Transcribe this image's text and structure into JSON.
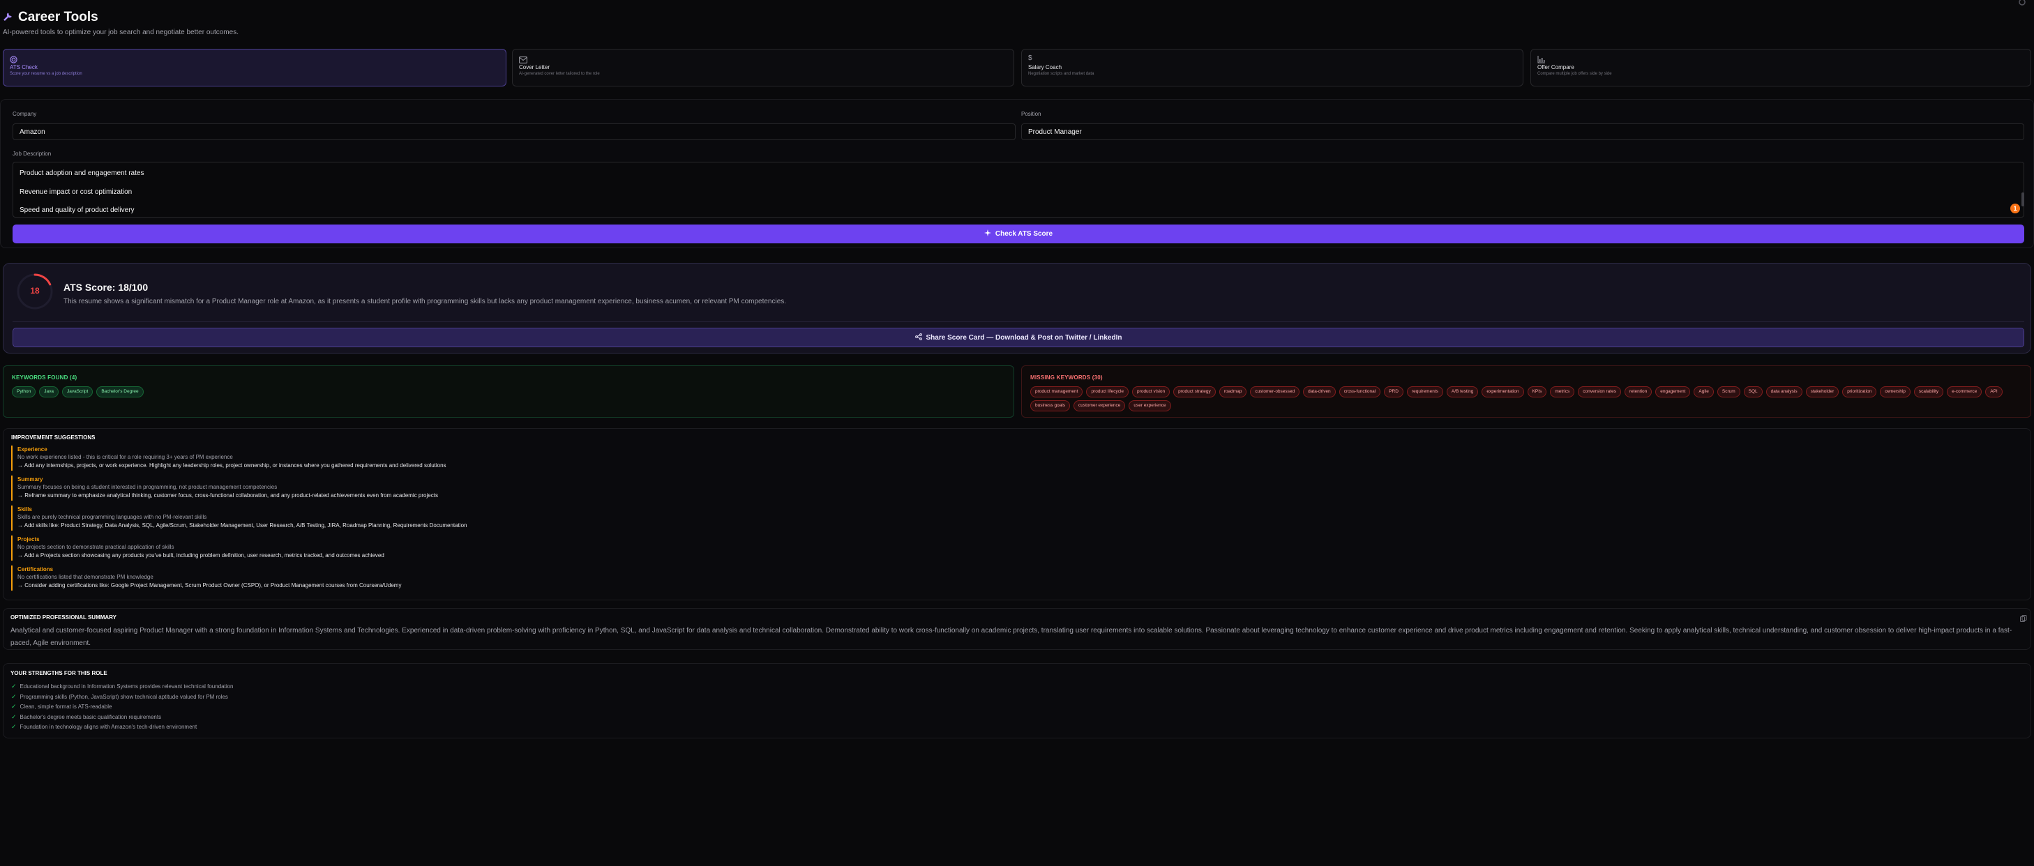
{
  "header": {
    "title": "Career Tools",
    "subtitle": "AI-powered tools to optimize your job search and negotiate better outcomes."
  },
  "tools": [
    {
      "name": "ATS Check",
      "desc": "Score your resume vs a job description",
      "icon": "target-icon"
    },
    {
      "name": "Cover Letter",
      "desc": "AI-generated cover letter tailored to the role",
      "icon": "mail-icon"
    },
    {
      "name": "Salary Coach",
      "desc": "Negotiation scripts and market data",
      "icon": "dollar-icon"
    },
    {
      "name": "Offer Compare",
      "desc": "Compare multiple job offers side by side",
      "icon": "bar-chart-icon"
    }
  ],
  "form": {
    "company_label": "Company",
    "company_value": "Amazon",
    "position_label": "Position",
    "position_value": "Product Manager",
    "jd_label": "Job Description",
    "jd_lines": [
      "Product adoption and engagement rates",
      "Revenue impact or cost optimization",
      "Speed and quality of product delivery"
    ],
    "badge": "1",
    "check_button": "Check ATS Score"
  },
  "score": {
    "value": 18,
    "max": 100,
    "title": "ATS Score: 18/100",
    "description": "This resume shows a significant mismatch for a Product Manager role at Amazon, as it presents a student profile with programming skills but lacks any product management experience, business acumen, or relevant PM competencies.",
    "share_button": "Share Score Card — Download & Post on Twitter / LinkedIn"
  },
  "keywords_found": {
    "title": "KEYWORDS FOUND (4)",
    "items": [
      "Python",
      "Java",
      "JavaScript",
      "Bachelor's Degree"
    ]
  },
  "missing_keywords": {
    "title": "MISSING KEYWORDS (30)",
    "items": [
      "product management",
      "product lifecycle",
      "product vision",
      "product strategy",
      "roadmap",
      "customer-obsessed",
      "data-driven",
      "cross-functional",
      "PRD",
      "requirements",
      "A/B testing",
      "experimentation",
      "KPIs",
      "metrics",
      "conversion rates",
      "retention",
      "engagement",
      "Agile",
      "Scrum",
      "SQL",
      "data analysis",
      "stakeholder",
      "prioritization",
      "ownership",
      "scalability",
      "e-commerce",
      "API",
      "business goals",
      "customer experience",
      "user experience"
    ]
  },
  "improvements": {
    "title": "IMPROVEMENT SUGGESTIONS",
    "items": [
      {
        "category": "Experience",
        "issue": "No work experience listed - this is critical for a role requiring 3+ years of PM experience",
        "fix": "→ Add any internships, projects, or work experience. Highlight any leadership roles, project ownership, or instances where you gathered requirements and delivered solutions"
      },
      {
        "category": "Summary",
        "issue": "Summary focuses on being a student interested in programming, not product management competencies",
        "fix": "→ Reframe summary to emphasize analytical thinking, customer focus, cross-functional collaboration, and any product-related achievements even from academic projects"
      },
      {
        "category": "Skills",
        "issue": "Skills are purely technical programming languages with no PM-relevant skills",
        "fix": "→ Add skills like: Product Strategy, Data Analysis, SQL, Agile/Scrum, Stakeholder Management, User Research, A/B Testing, JIRA, Roadmap Planning, Requirements Documentation"
      },
      {
        "category": "Projects",
        "issue": "No projects section to demonstrate practical application of skills",
        "fix": "→ Add a Projects section showcasing any products you've built, including problem definition, user research, metrics tracked, and outcomes achieved"
      },
      {
        "category": "Certifications",
        "issue": "No certifications listed that demonstrate PM knowledge",
        "fix": "→ Consider adding certifications like: Google Project Management, Scrum Product Owner (CSPO), or Product Management courses from Coursera/Udemy"
      }
    ]
  },
  "summary": {
    "title": "OPTIMIZED PROFESSIONAL SUMMARY",
    "text": "Analytical and customer-focused aspiring Product Manager with a strong foundation in Information Systems and Technologies. Experienced in data-driven problem-solving with proficiency in Python, SQL, and JavaScript for data analysis and technical collaboration. Demonstrated ability to work cross-functionally on academic projects, translating user requirements into scalable solutions. Passionate about leveraging technology to enhance customer experience and drive product metrics including engagement and retention. Seeking to apply analytical skills, technical understanding, and customer obsession to deliver high-impact products in a fast-paced, Agile environment."
  },
  "strengths": {
    "title": "YOUR STRENGTHS FOR THIS ROLE",
    "items": [
      "Educational background in Information Systems provides relevant technical foundation",
      "Programming skills (Python, JavaScript) show technical aptitude valued for PM roles",
      "Clean, simple format is ATS-readable",
      "Bachelor's degree meets basic qualification requirements",
      "Foundation in technology aligns with Amazon's tech-driven environment"
    ]
  },
  "colors": {
    "accent": "#6d42f0",
    "score_red": "#ef4444",
    "found_green": "#4ade80",
    "missing_red": "#f87171",
    "suggestion_amber": "#f59e0b"
  }
}
